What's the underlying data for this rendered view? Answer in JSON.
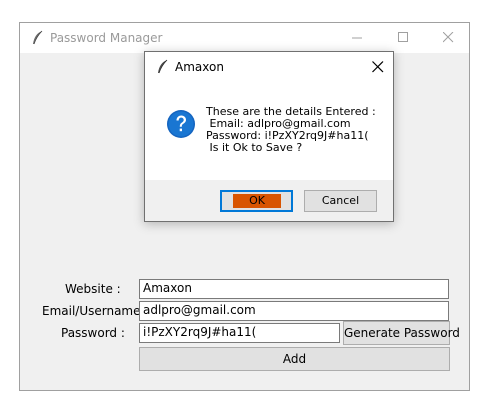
{
  "main_window": {
    "title": "Password Manager",
    "icon": "feather-icon",
    "controls": [
      "minimize-icon",
      "maximize-icon",
      "close-icon"
    ]
  },
  "form": {
    "website_label": "Website :",
    "website_value": "Amaxon",
    "email_label": "Email/Username :",
    "email_value": "adlpro@gmail.com",
    "password_label": "Password :",
    "password_value": "i!PzXY2rq9J#ha11(",
    "generate_button": "Generate Password",
    "add_button": "Add"
  },
  "dialog": {
    "title": "Amaxon",
    "icon": "question-icon",
    "message_lines": [
      "These are the details Entered :",
      " Email: adlpro@gmail.com",
      "Password: i!PzXY2rq9J#ha11(",
      " Is it Ok to Save ?"
    ],
    "ok_label": "OK",
    "cancel_label": "Cancel",
    "ok_highlight_color": "#d85400",
    "focus_color": "#0078d7"
  }
}
